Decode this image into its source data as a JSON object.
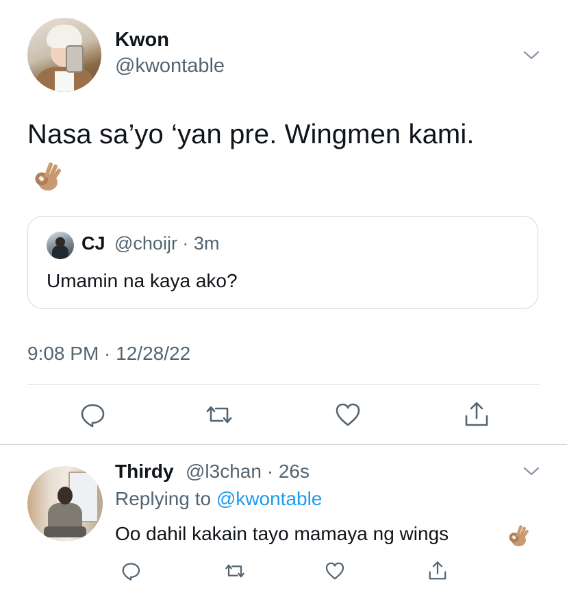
{
  "main_tweet": {
    "author_name": "Kwon",
    "author_handle": "@kwontable",
    "text": "Nasa sa’yo ‘yan pre. Wingmen kami.",
    "emoji": "ok-hand-emoji",
    "timestamp": "9:08 PM · 12/28/22"
  },
  "quoted_tweet": {
    "author_name": "CJ",
    "author_handle": "@choijr · 3m",
    "text": "Umamin na kaya ako?"
  },
  "reply": {
    "author_name": "Thirdy",
    "author_handle": "@l3chan · 26s",
    "replying_prefix": "Replying to",
    "replying_to": "@kwontable",
    "text": "Oo dahil kakain tayo mamaya ng wings",
    "emoji": "ok-hand-emoji"
  },
  "icons": {
    "reply": "reply-icon",
    "retweet": "retweet-icon",
    "like": "heart-icon",
    "share": "share-icon",
    "more": "chevron-down-icon"
  },
  "colors": {
    "text_primary": "#0f1419",
    "text_secondary": "#536471",
    "link": "#1d9bf0",
    "border": "#cfd9de"
  }
}
